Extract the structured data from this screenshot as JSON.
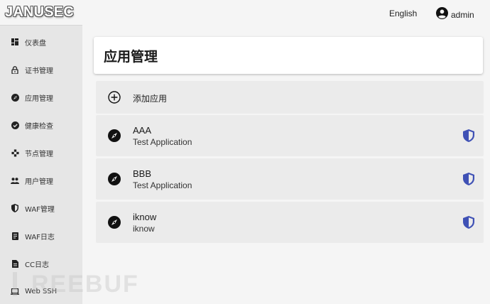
{
  "app": {
    "logo": "JANUSEC"
  },
  "topbar": {
    "language": "English",
    "user": "admin"
  },
  "sidebar": {
    "items": [
      {
        "label": "仪表盘",
        "icon": "dashboard-icon"
      },
      {
        "label": "证书管理",
        "icon": "lock-icon"
      },
      {
        "label": "应用管理",
        "icon": "compass-icon"
      },
      {
        "label": "健康检查",
        "icon": "check-circle-icon"
      },
      {
        "label": "节点管理",
        "icon": "nodes-icon"
      },
      {
        "label": "用户管理",
        "icon": "people-icon"
      },
      {
        "label": "WAF管理",
        "icon": "shield-icon"
      },
      {
        "label": "WAF日志",
        "icon": "log-icon"
      },
      {
        "label": "CC日志",
        "icon": "document-icon"
      },
      {
        "label": "Web SSH",
        "icon": "laptop-icon"
      }
    ]
  },
  "main": {
    "title": "应用管理",
    "add_label": "添加应用",
    "apps": [
      {
        "name": "AAA",
        "description": "Test Application"
      },
      {
        "name": "BBB",
        "description": "Test Application"
      },
      {
        "name": "iknow",
        "description": "iknow"
      }
    ]
  },
  "watermark": "REEBUF",
  "colors": {
    "shield": "#3f51b5",
    "sidebar_bg": "#e6e6e6",
    "content_bg": "#f5f5f5",
    "row_bg": "#ebebeb"
  }
}
